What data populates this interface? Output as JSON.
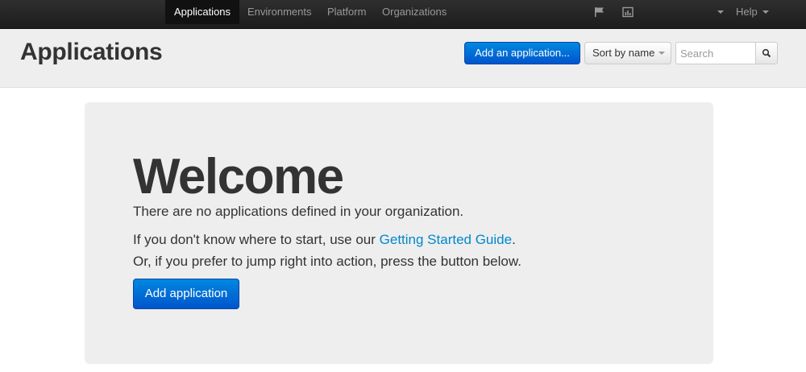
{
  "navbar": {
    "items": [
      {
        "label": "Applications",
        "active": true
      },
      {
        "label": "Environments",
        "active": false
      },
      {
        "label": "Platform",
        "active": false
      },
      {
        "label": "Organizations",
        "active": false
      }
    ],
    "icons": [
      "flag-icon",
      "chart-icon"
    ],
    "help_label": "Help"
  },
  "header": {
    "title": "Applications",
    "add_button_label": "Add an application...",
    "sort_label": "Sort by name",
    "search_placeholder": "Search",
    "search_icon": "search-icon"
  },
  "welcome": {
    "heading": "Welcome",
    "line1": "There are no applications defined in your organization.",
    "line2_prefix": "If you don't know where to start, use our ",
    "line2_link": "Getting Started Guide",
    "line2_suffix": ".",
    "line3": "Or, if you prefer to jump right into action, press the button below.",
    "button_label": "Add application"
  },
  "colors": {
    "navbar": "#222222",
    "primary": "#0066dd",
    "link": "#0088cc",
    "panel": "#eeeeee"
  }
}
